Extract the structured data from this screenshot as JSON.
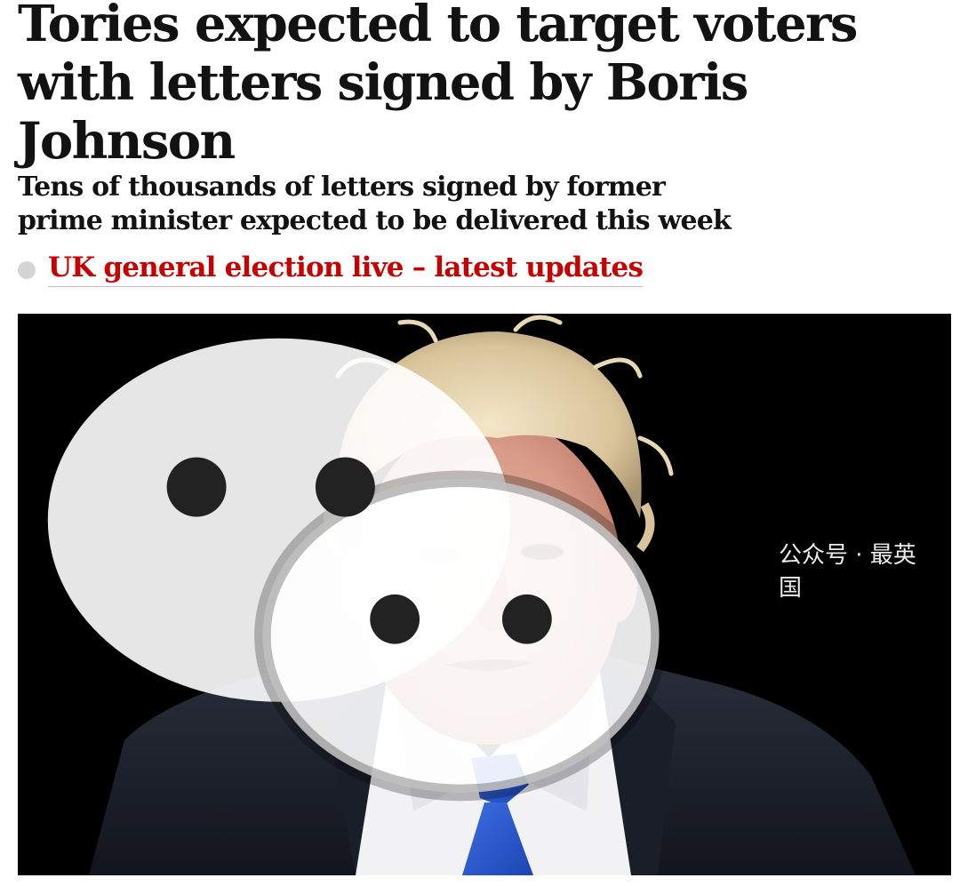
{
  "article": {
    "headline": "Tories expected to target voters with letters signed by Boris Johnson",
    "standfirst": "Tens of thousands of letters signed by former prime minister expected to be delivered this week",
    "live_link_label": "UK general election live – latest updates"
  },
  "hero_image": {
    "subject": "man-in-dark-suit-with-blue-tie",
    "background_color": "#000000"
  },
  "watermark": {
    "icon": "wechat-icon",
    "text": "公众号 · 最英国"
  },
  "colors": {
    "headline": "#121212",
    "link": "#c70000",
    "live_dot": "#d4d4d4"
  }
}
